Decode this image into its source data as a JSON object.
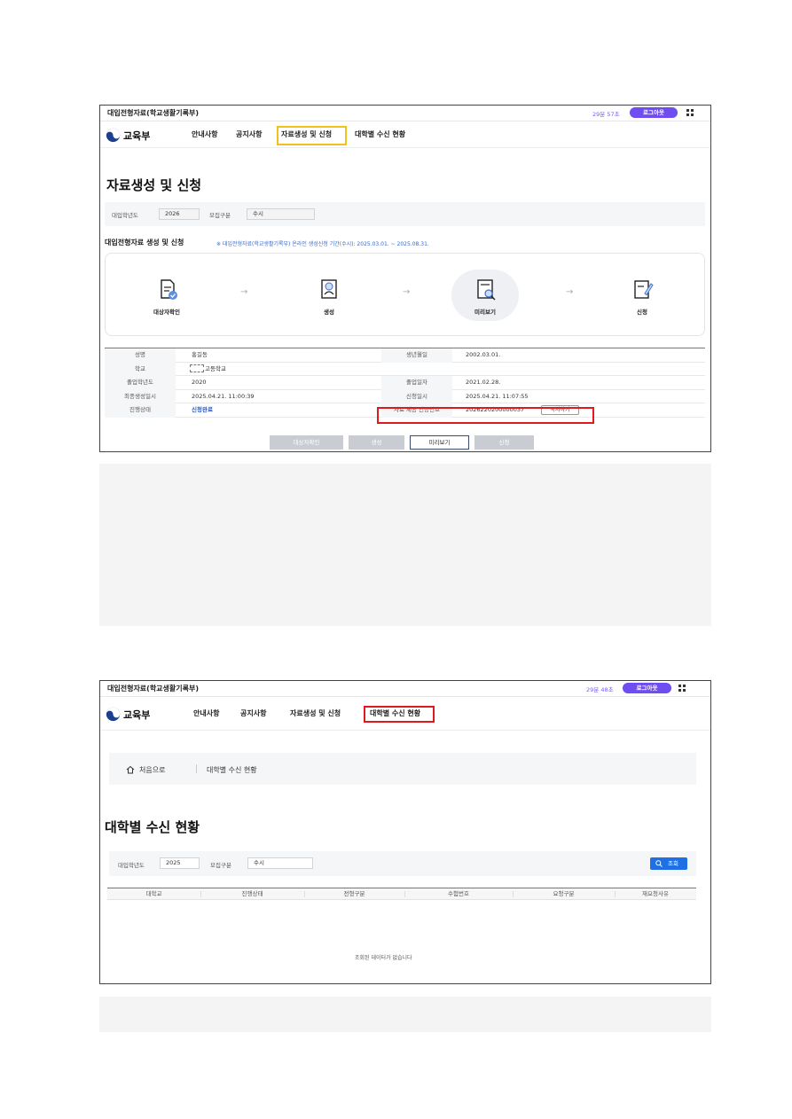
{
  "screens": [
    {
      "window_title": "대입전형자료(학교생활기록부)",
      "timer": "29분 57초",
      "logout_label": "로그아웃",
      "logo_text": "교육부",
      "menu": [
        "안내사항",
        "공지사항",
        "자료생성 및 신청",
        "대학별 수신 현황"
      ],
      "page_title": "자료생성 및 신청",
      "filter": {
        "year_label": "대입학년도",
        "year_value": "2026",
        "type_label": "모집구분",
        "type_value": "수시"
      },
      "section_title": "대입전형자료 생성 및 신청",
      "section_note": "※ 대입전형자료(학교생활기록부) 온라인 생성신청 기간(수시): 2025.03.01. ~ 2025.08.31.",
      "steps": [
        {
          "label": "대상자확인",
          "icon": "document-check-icon"
        },
        {
          "label": "생성",
          "icon": "document-person-icon"
        },
        {
          "label": "미리보기",
          "icon": "document-search-icon"
        },
        {
          "label": "신청",
          "icon": "document-pen-icon"
        }
      ],
      "info": {
        "name_label": "성명",
        "name": "홍길동",
        "birth_label": "생년월일",
        "birth": "2002.03.01.",
        "school_label": "학교",
        "school": "고등학교",
        "grad_year_label": "졸업학년도",
        "grad_year": "2020",
        "grad_date_label": "졸업일자",
        "grad_date": "2021.02.28.",
        "created_label": "최종생성일시",
        "created": "2025.04.21. 11:00:39",
        "applied_label": "신청일시",
        "applied": "2025.04.21. 11:07:55",
        "status_label": "진행상태",
        "status": "신청완료",
        "cert_label": "자료 제공 인증번호",
        "cert": "2026220200000037",
        "copy_label": "복사하기"
      },
      "buttons": [
        "대상자확인",
        "생성",
        "미리보기",
        "신청"
      ]
    },
    {
      "window_title": "대입전형자료(학교생활기록부)",
      "timer": "29분 48초",
      "logout_label": "로그아웃",
      "logo_text": "교육부",
      "menu": [
        "안내사항",
        "공지사항",
        "자료생성 및 신청",
        "대학별 수신 현황"
      ],
      "breadcrumb": {
        "home": "처음으로",
        "current": "대학별 수신 현황"
      },
      "page_title": "대학별 수신 현황",
      "filter": {
        "year_label": "대입학년도",
        "year_value": "2025",
        "type_label": "모집구분",
        "type_value": "수시"
      },
      "search_label": "조회",
      "columns": [
        "대학교",
        "진행상태",
        "전형구분",
        "수험번호",
        "요청구분",
        "재요청사유"
      ],
      "empty_message": "조회된 데이터가 없습니다"
    }
  ],
  "colors": {
    "accent_purple": "#6f4df0",
    "highlight_yellow": "#f3c21a",
    "highlight_red": "#e0191c",
    "link_blue": "#2b59c3",
    "search_blue": "#1f6fe5"
  }
}
